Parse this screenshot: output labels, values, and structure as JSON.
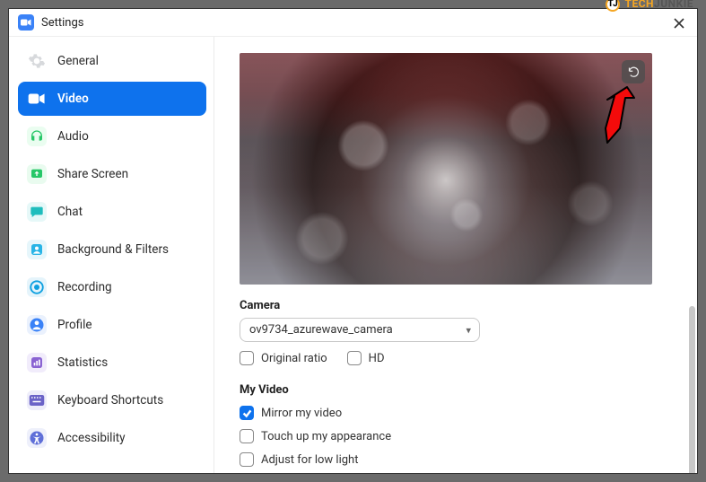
{
  "watermark": {
    "brand1": "TECH",
    "brand2": "JUNKIE",
    "badge": "TJ"
  },
  "window": {
    "title": "Settings"
  },
  "sidebar": {
    "items": [
      {
        "label": "General"
      },
      {
        "label": "Video"
      },
      {
        "label": "Audio"
      },
      {
        "label": "Share Screen"
      },
      {
        "label": "Chat"
      },
      {
        "label": "Background & Filters"
      },
      {
        "label": "Recording"
      },
      {
        "label": "Profile"
      },
      {
        "label": "Statistics"
      },
      {
        "label": "Keyboard Shortcuts"
      },
      {
        "label": "Accessibility"
      }
    ]
  },
  "content": {
    "camera_label": "Camera",
    "camera_selected": "ov9734_azurewave_camera",
    "original_ratio": "Original ratio",
    "hd": "HD",
    "my_video_label": "My Video",
    "mirror": "Mirror my video",
    "touchup": "Touch up my appearance",
    "lowlight": "Adjust for low light"
  }
}
